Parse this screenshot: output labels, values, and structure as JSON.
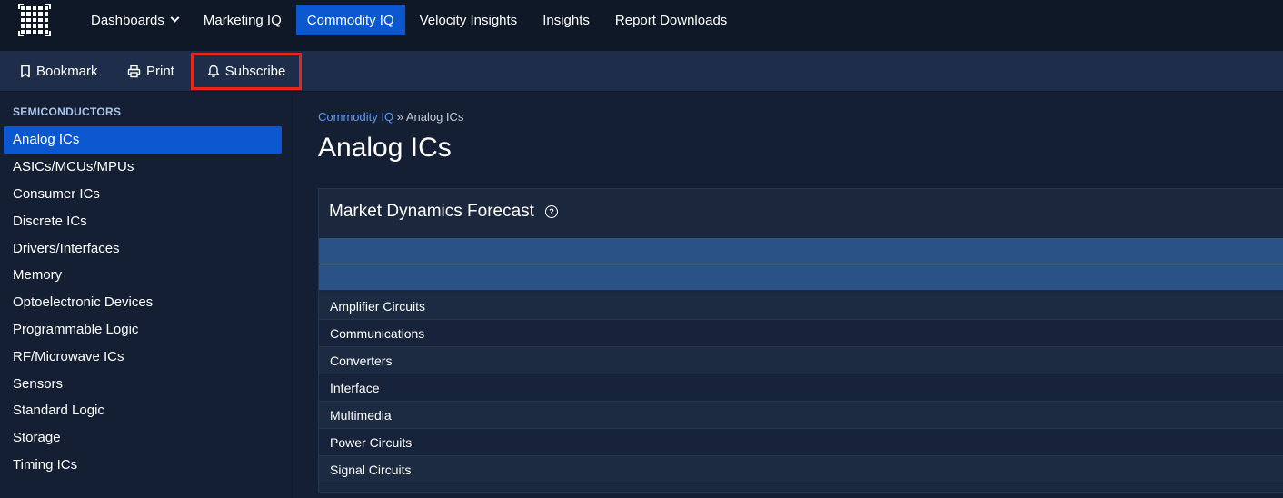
{
  "topnav": {
    "items": [
      {
        "label": "Dashboards",
        "active": false,
        "dropdown": true
      },
      {
        "label": "Marketing IQ",
        "active": false
      },
      {
        "label": "Commodity IQ",
        "active": true
      },
      {
        "label": "Velocity Insights",
        "active": false
      },
      {
        "label": "Insights",
        "active": false
      },
      {
        "label": "Report Downloads",
        "active": false
      }
    ]
  },
  "actions": {
    "bookmark": "Bookmark",
    "print": "Print",
    "subscribe": "Subscribe"
  },
  "sidebar": {
    "heading": "SEMICONDUCTORS",
    "items": [
      {
        "label": "Analog ICs",
        "active": true
      },
      {
        "label": "ASICs/MCUs/MPUs"
      },
      {
        "label": "Consumer ICs"
      },
      {
        "label": "Discrete ICs"
      },
      {
        "label": "Drivers/Interfaces"
      },
      {
        "label": "Memory"
      },
      {
        "label": "Optoelectronic Devices"
      },
      {
        "label": "Programmable Logic"
      },
      {
        "label": "RF/Microwave ICs"
      },
      {
        "label": "Sensors"
      },
      {
        "label": "Standard Logic"
      },
      {
        "label": "Storage"
      },
      {
        "label": "Timing ICs"
      }
    ]
  },
  "breadcrumb": {
    "root": "Commodity IQ",
    "separator": "»",
    "current": "Analog ICs"
  },
  "page": {
    "title": "Analog ICs"
  },
  "card": {
    "title": "Market Dynamics Forecast",
    "help_glyph": "?",
    "rows": [
      "Amplifier Circuits",
      "Communications",
      "Converters",
      "Interface",
      "Multimedia",
      "Power Circuits",
      "Signal Circuits"
    ]
  },
  "colors": {
    "accent": "#0b57d0",
    "highlight_border": "#e8261c",
    "table_header": "#2b5286",
    "link": "#5b9bf0"
  }
}
